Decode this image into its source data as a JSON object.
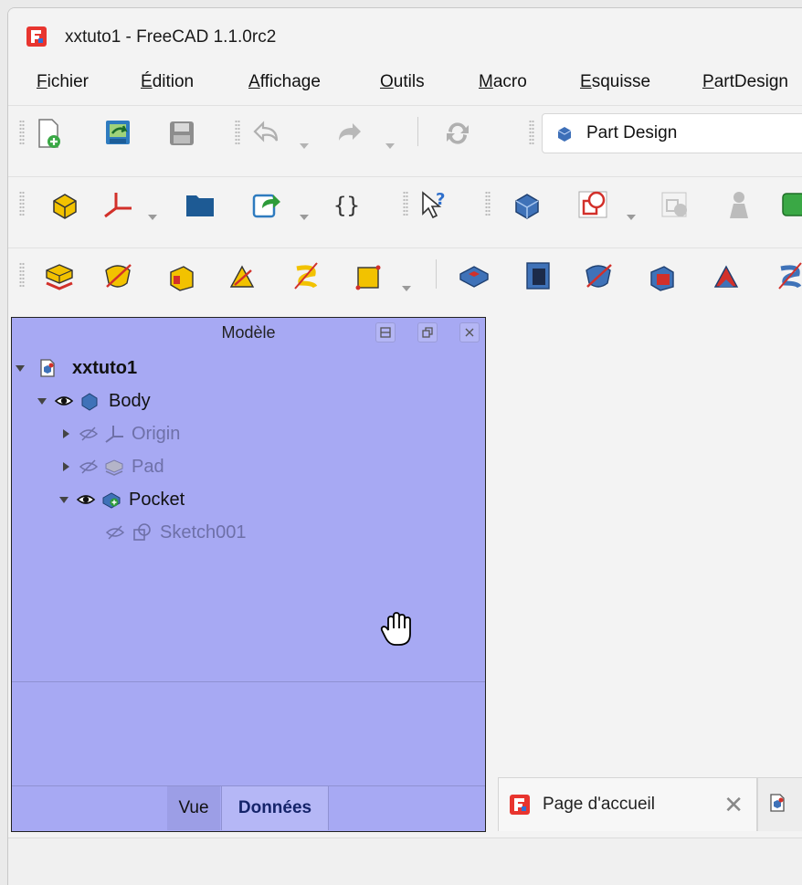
{
  "window": {
    "title": "xxtuto1 - FreeCAD 1.1.0rc2"
  },
  "menubar": {
    "items": [
      {
        "label_underlined": "F",
        "label_rest": "ichier"
      },
      {
        "label_underlined": "É",
        "label_rest": "dition"
      },
      {
        "label_underlined": "A",
        "label_rest": "ffichage"
      },
      {
        "label_underlined": "O",
        "label_rest": "utils"
      },
      {
        "label_underlined": "M",
        "label_rest": "acro"
      },
      {
        "label_underlined": "E",
        "label_rest": "squisse"
      },
      {
        "label_underlined": "P",
        "label_rest": "artDesign"
      }
    ]
  },
  "workbench": {
    "selected": "Part Design"
  },
  "model_panel": {
    "title": "Modèle",
    "tree": [
      {
        "label": "xxtuto1",
        "bold": true
      },
      {
        "label": "Body"
      },
      {
        "label": "Origin"
      },
      {
        "label": "Pad"
      },
      {
        "label": "Pocket"
      },
      {
        "label": "Sketch001"
      }
    ],
    "tabs": {
      "view": "Vue",
      "data": "Données"
    }
  },
  "document_tabs": {
    "start_page": "Page d'accueil",
    "close_glyph": "✕"
  },
  "colors": {
    "panel_bg": "#a7a9f3",
    "active_tab_text": "#15246a"
  }
}
